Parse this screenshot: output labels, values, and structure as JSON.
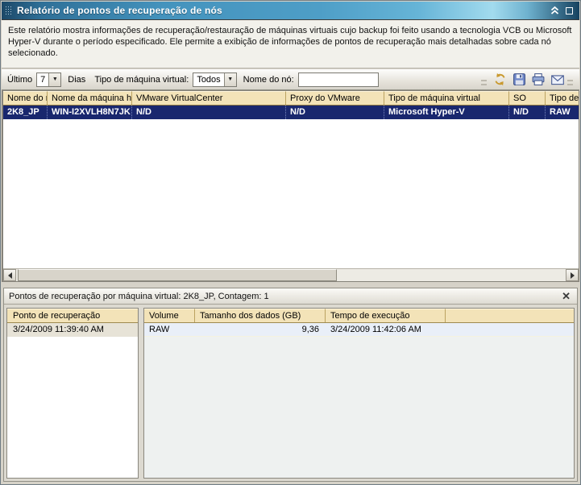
{
  "window": {
    "title": "Relatório de pontos de recuperação de nós",
    "description": "Este relatório mostra informações de recuperação/restauração de máquinas virtuais cujo backup foi feito usando a tecnologia VCB ou Microsoft Hyper-V durante o período especificado. Ele permite a exibição de informações de pontos de recuperação mais detalhadas sobre cada nó selecionado."
  },
  "toolbar": {
    "last_label": "Último",
    "days_value": "7",
    "days_label": "Dias",
    "vm_type_label": "Tipo de máquina virtual:",
    "vm_type_value": "Todos",
    "node_name_label": "Nome do nó:",
    "node_name_value": "",
    "icons": {
      "refresh": "refresh-icon",
      "save": "save-icon",
      "print": "print-icon",
      "email": "email-icon"
    }
  },
  "nodes_table": {
    "columns": [
      "Nome do nó",
      "Nome da máquina host",
      "VMware VirtualCenter",
      "Proxy do VMware",
      "Tipo de máquina virtual",
      "SO",
      "Tipo de"
    ],
    "rows": [
      [
        "2K8_JP",
        "WIN-I2XVLH8N7JK",
        "N/D",
        "N/D",
        "Microsoft Hyper-V",
        "N/D",
        "RAW"
      ]
    ]
  },
  "detail_panel": {
    "title": "Pontos de recuperação por máquina virtual: 2K8_JP, Contagem: 1",
    "recovery_list": {
      "header": "Ponto de recuperação",
      "items": [
        "3/24/2009 11:39:40 AM"
      ]
    },
    "volumes_table": {
      "columns": [
        "Volume",
        "Tamanho dos dados (GB)",
        "Tempo de execução",
        ""
      ],
      "rows": [
        [
          "RAW",
          "9,36",
          "3/24/2009 11:42:06 AM",
          ""
        ]
      ]
    }
  },
  "colors": {
    "titlebar_blue": "#4e9ec7",
    "selected_row_navy": "#19276E",
    "header_tan": "#F3E3B8",
    "detail_row_blue": "#E9EFF8"
  }
}
